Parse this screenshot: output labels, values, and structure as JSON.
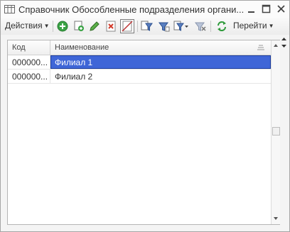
{
  "window": {
    "title": "Справочник Обособленные подразделения органи..."
  },
  "toolbar": {
    "actions_label": "Действия",
    "goto_label": "Перейти"
  },
  "table": {
    "columns": [
      "Код",
      "Наименование"
    ],
    "rows": [
      {
        "code": "000000...",
        "name": "Филиал 1",
        "selected": true
      },
      {
        "code": "000000...",
        "name": "Филиал 2",
        "selected": false
      }
    ]
  },
  "colors": {
    "selection": "#3f66d7",
    "add_icon": "#3aa345",
    "delete_icon": "#d23b2c",
    "refresh_icon": "#2e9a3a"
  },
  "icons": [
    "table-icon",
    "minimize-icon",
    "maximize-icon",
    "close-icon",
    "add-icon",
    "copy-icon",
    "edit-icon",
    "delete-icon",
    "mark-deletion-icon",
    "filter-icon",
    "filter-by-value-icon",
    "filter-dropdown-icon",
    "clear-filter-icon",
    "refresh-icon",
    "sort-icon"
  ]
}
